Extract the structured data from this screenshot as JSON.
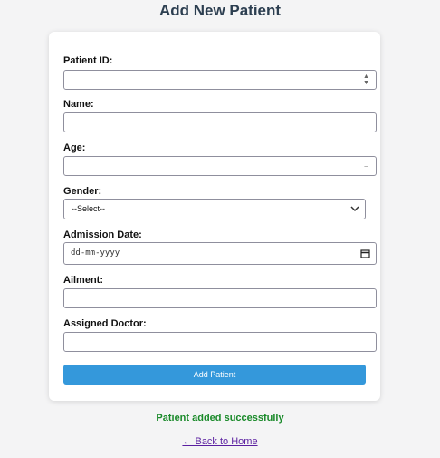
{
  "page": {
    "title": "Add New Patient"
  },
  "form": {
    "patient_id": {
      "label": "Patient ID:",
      "value": ""
    },
    "name": {
      "label": "Name:",
      "value": ""
    },
    "age": {
      "label": "Age:",
      "value": ""
    },
    "gender": {
      "label": "Gender:",
      "selected": "--Select--"
    },
    "admission_date": {
      "label": "Admission Date:",
      "placeholder": "dd-mm-yyyy"
    },
    "ailment": {
      "label": "Ailment:",
      "value": ""
    },
    "doctor": {
      "label": "Assigned Doctor:",
      "value": ""
    },
    "submit_label": "Add Patient"
  },
  "status": {
    "message": "Patient added successfully",
    "color": "#1a8a2a"
  },
  "nav": {
    "back_label": "← Back to Home"
  },
  "colors": {
    "accent": "#3498db",
    "title": "#2c3e50",
    "link": "#5a1fa0"
  }
}
